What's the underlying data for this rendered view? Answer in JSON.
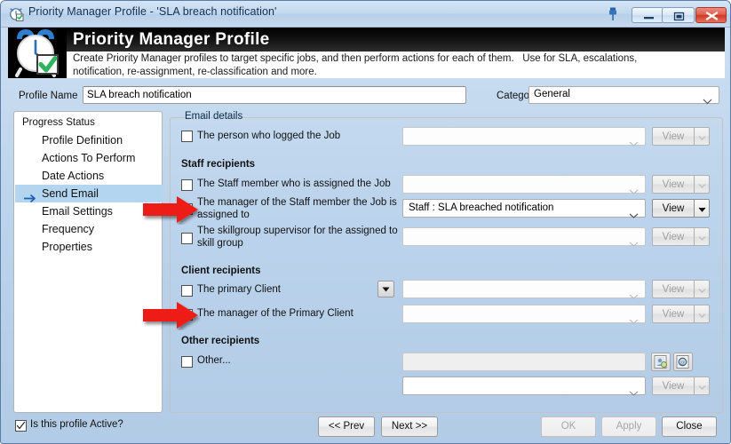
{
  "window": {
    "title": "Priority Manager Profile - 'SLA breach notification'",
    "title_icon": "alarm-clock-check-icon",
    "controls": {
      "pin": "pin-icon",
      "minimize": "minimize-icon",
      "maximize": "maximize-icon",
      "close": "close-icon"
    },
    "accent_blue": "#b4d5f0",
    "close_red": "#cf3a26"
  },
  "banner": {
    "icon": "alarm-clock-check-icon",
    "title": "Priority Manager Profile",
    "description_line1": "Create Priority Manager profiles to target specific jobs, and then perform actions for each of them.   Use for SLA, escalations,",
    "description_line2": "notification, re-assignment, re-classification and more."
  },
  "form": {
    "profile_name_label": "Profile Name",
    "profile_name_value": "SLA breach notification",
    "profile_name_placeholder": "",
    "category_label": "Category",
    "category_value": "General"
  },
  "sidebar": {
    "header": "Progress Status",
    "items": [
      {
        "label": "Profile Definition",
        "active": false
      },
      {
        "label": "Actions To Perform",
        "active": false
      },
      {
        "label": "Date Actions",
        "active": false
      },
      {
        "label": "Send Email",
        "active": true
      },
      {
        "label": "Email Settings",
        "active": false
      },
      {
        "label": "Frequency",
        "active": false
      },
      {
        "label": "Properties",
        "active": false
      }
    ]
  },
  "main": {
    "group_legend": "Email details",
    "rows": {
      "person_logged": {
        "label": "The person who logged the Job",
        "checked": false,
        "combo_value": "",
        "view_label": "View",
        "view_enabled": false
      },
      "staff_header": "Staff recipients",
      "staff_assigned": {
        "label": "The Staff member who is assigned the Job",
        "checked": false,
        "combo_value": "",
        "view_label": "View",
        "view_enabled": false
      },
      "staff_manager": {
        "label_line1": "The manager of the Staff member the Job is",
        "label_line2": "assigned to",
        "checked": true,
        "combo_value": "Staff : SLA breached notification",
        "view_label": "View",
        "view_enabled": true
      },
      "skillgroup_supervisor": {
        "label_line1": "The skillgroup supervisor for the assigned to",
        "label_line2": "skill group",
        "checked": false,
        "combo_value": "",
        "view_label": "View",
        "view_enabled": false
      },
      "client_header": "Client recipients",
      "primary_client": {
        "label": "The primary Client",
        "checked": false,
        "dropdown_toggle": "triangle-down-icon",
        "combo_value": "",
        "view_label": "View",
        "view_enabled": false
      },
      "primary_client_manager": {
        "label": "The manager of the Primary Client",
        "checked": false,
        "combo_value": "",
        "view_label": "View",
        "view_enabled": false
      },
      "other_header": "Other recipients",
      "other": {
        "label": "Other...",
        "checked": false,
        "textbox_value": "",
        "icon_contacts": "select-contact-icon",
        "icon_email": "email-address-icon"
      },
      "other_template": {
        "combo_value": "",
        "view_label": "View",
        "view_enabled": false
      }
    }
  },
  "footer": {
    "active_checkbox_label": "Is this profile Active?",
    "active_checked": true,
    "prev_label": "<< Prev",
    "next_label": "Next >>",
    "ok_label": "OK",
    "ok_enabled": false,
    "apply_label": "Apply",
    "apply_enabled": false,
    "close_label": "Close",
    "close_enabled": true
  },
  "annotations": {
    "arrow_color": "#e01b1b",
    "arrow1_target": "staff-manager-checkbox",
    "arrow2_target": "primary-client-manager-checkbox"
  }
}
